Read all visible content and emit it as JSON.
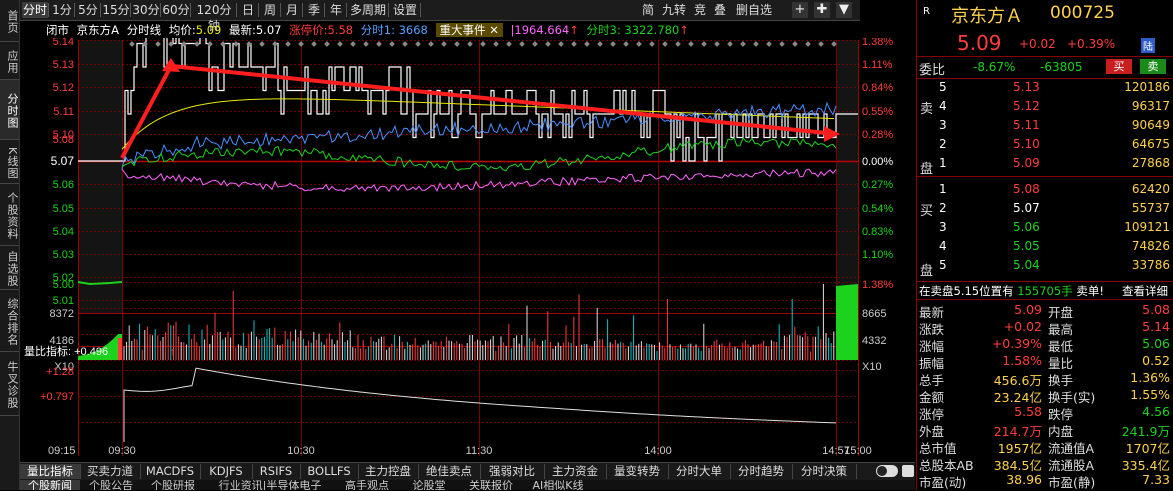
{
  "sidebar": [
    {
      "label": "首页",
      "active": false
    },
    {
      "label": "应用",
      "active": false
    },
    {
      "label": "分时图",
      "active": true
    },
    {
      "label": "K线图",
      "active": false
    },
    {
      "label": "个股资料",
      "active": false
    },
    {
      "label": "自选股",
      "active": false
    },
    {
      "label": "综合排名",
      "active": false
    },
    {
      "label": "牛叉诊股",
      "active": false
    }
  ],
  "toolbar": {
    "periods": [
      "分时",
      "1分",
      "5分",
      "15分",
      "30分",
      "60分",
      "120分钟",
      "日",
      "周",
      "月",
      "季",
      "年",
      "多周期",
      "设置"
    ],
    "active_period": "分时",
    "right_items": [
      "简",
      "九转",
      "竞",
      "叠",
      "删自选"
    ],
    "icons": [
      "+",
      "✚",
      "▼"
    ]
  },
  "infoline": {
    "status": "闭市",
    "stock": "京东方A",
    "chart_type": "分时线",
    "avg_label": "均价:",
    "avg_value": "5.09",
    "latest_label": "最新:",
    "latest_value": "5.07",
    "limit_label": "涨停价:",
    "limit_value": "5.58",
    "ind1": "分时1: 3668",
    "event_label": "重大事件",
    "ind2": "1964.664",
    "ind3": "分时3: 3322.780"
  },
  "price_axis_left": [
    "5.14",
    "5.13",
    "5.12",
    "5.11",
    "5.10",
    "5.08",
    "5.07",
    "5.06",
    "5.05",
    "5.04",
    "5.03",
    "5.02",
    "5.01"
  ],
  "pct_axis_right": [
    "1.38%",
    "1.11%",
    "0.84%",
    "0.55%",
    "0.28%",
    "0.00%",
    "0.27%",
    "0.54%",
    "0.83%",
    "1.10%"
  ],
  "volume_axis_left": [
    "5.00",
    "8372",
    "4186",
    "X10"
  ],
  "volume_axis_right": [
    "1.38%",
    "8665",
    "4332",
    "X10"
  ],
  "indicator": {
    "name": "量比指标:",
    "value": "+0.496",
    "axis": [
      "+1.28",
      "+0.797"
    ]
  },
  "time_axis": [
    "09:15",
    "09:30",
    "10:30",
    "11:30",
    "14:00",
    "14:57",
    "15:00"
  ],
  "bottom_tabs": [
    "量比指标",
    "买卖力道",
    "MACDFS",
    "KDJFS",
    "RSIFS",
    "BOLLFS",
    "主力控盘",
    "绝佳卖点",
    "强弱对比",
    "主力资金",
    "量变转势",
    "分时大单",
    "分时趋势",
    "分时决策"
  ],
  "bottom_tabs_active": "量比指标",
  "bottom_tabs2": [
    "个股新闻",
    "个股公告",
    "个股研报",
    "行业资讯|半导体电子",
    "高手观点",
    "论股堂",
    "关联报价",
    "AI相似K线"
  ],
  "quote": {
    "badge": "R",
    "name": "京东方Ａ",
    "code": "000725",
    "price": "5.09",
    "change": "+0.02",
    "change_pct": "+0.39%",
    "tag": "陆",
    "weibi_label": "委比",
    "weibi_pct": "-8.67%",
    "weibi_val": "-63805",
    "buy_btn": "买",
    "sell_btn": "卖",
    "sell_label": [
      "卖",
      "盘"
    ],
    "buy_label": [
      "买",
      "盘"
    ],
    "asks": [
      {
        "level": "5",
        "price": "5.13",
        "vol": "120186"
      },
      {
        "level": "4",
        "price": "5.12",
        "vol": "96317"
      },
      {
        "level": "3",
        "price": "5.11",
        "vol": "90649"
      },
      {
        "level": "2",
        "price": "5.10",
        "vol": "64675"
      },
      {
        "level": "1",
        "price": "5.09",
        "vol": "27868"
      }
    ],
    "bids": [
      {
        "level": "1",
        "price": "5.08",
        "vol": "62420"
      },
      {
        "level": "2",
        "price": "5.07",
        "vol": "55737"
      },
      {
        "level": "3",
        "price": "5.06",
        "vol": "109121"
      },
      {
        "level": "4",
        "price": "5.05",
        "vol": "74826"
      },
      {
        "level": "5",
        "price": "5.04",
        "vol": "33786"
      }
    ],
    "notice_text": "在卖盘5.15位置有",
    "notice_vol": "155705手",
    "notice_tail": "卖单!",
    "notice_link": "查看详细",
    "stats": [
      {
        "l1": "最新",
        "v1": "5.09",
        "c1": "red",
        "l2": "开盘",
        "v2": "5.08",
        "c2": "red"
      },
      {
        "l1": "涨跌",
        "v1": "+0.02",
        "c1": "red",
        "l2": "最高",
        "v2": "5.14",
        "c2": "red"
      },
      {
        "l1": "涨幅",
        "v1": "+0.39%",
        "c1": "red",
        "l2": "最低",
        "v2": "5.06",
        "c2": "green"
      },
      {
        "l1": "振幅",
        "v1": "1.58%",
        "c1": "red",
        "l2": "量比",
        "v2": "0.52",
        "c2": "yellow"
      },
      {
        "l1": "总手",
        "v1": "456.6万",
        "c1": "yellow",
        "l2": "换手",
        "v2": "1.36%",
        "c2": "yellow"
      },
      {
        "l1": "金额",
        "v1": "23.24亿",
        "c1": "yellow",
        "l2": "换手(实)",
        "v2": "1.55%",
        "c2": "yellow"
      },
      {
        "l1": "涨停",
        "v1": "5.58",
        "c1": "red",
        "l2": "跌停",
        "v2": "4.56",
        "c2": "green"
      },
      {
        "l1": "外盘",
        "v1": "214.7万",
        "c1": "red",
        "l2": "内盘",
        "v2": "241.9万",
        "c2": "green"
      },
      {
        "l1": "总市值",
        "v1": "1957亿",
        "c1": "yellow",
        "l2": "流通值A",
        "v2": "1707亿",
        "c2": "yellow"
      },
      {
        "l1": "总股本AB",
        "v1": "384.5亿",
        "c1": "yellow",
        "l2": "流通股A",
        "v2": "335.4亿",
        "c2": "yellow"
      },
      {
        "l1": "市盈(动)",
        "v1": "38.96",
        "c1": "yellow",
        "l2": "市盈(静)",
        "v2": "7.33",
        "c2": "yellow"
      }
    ]
  },
  "colors": {
    "up": "#ff3c3c",
    "down": "#1cd21c",
    "grid": "#7a0000",
    "price_line": "#ffffff",
    "avg_line": "#e8e800",
    "annotation_arrow": "#ff2020"
  }
}
